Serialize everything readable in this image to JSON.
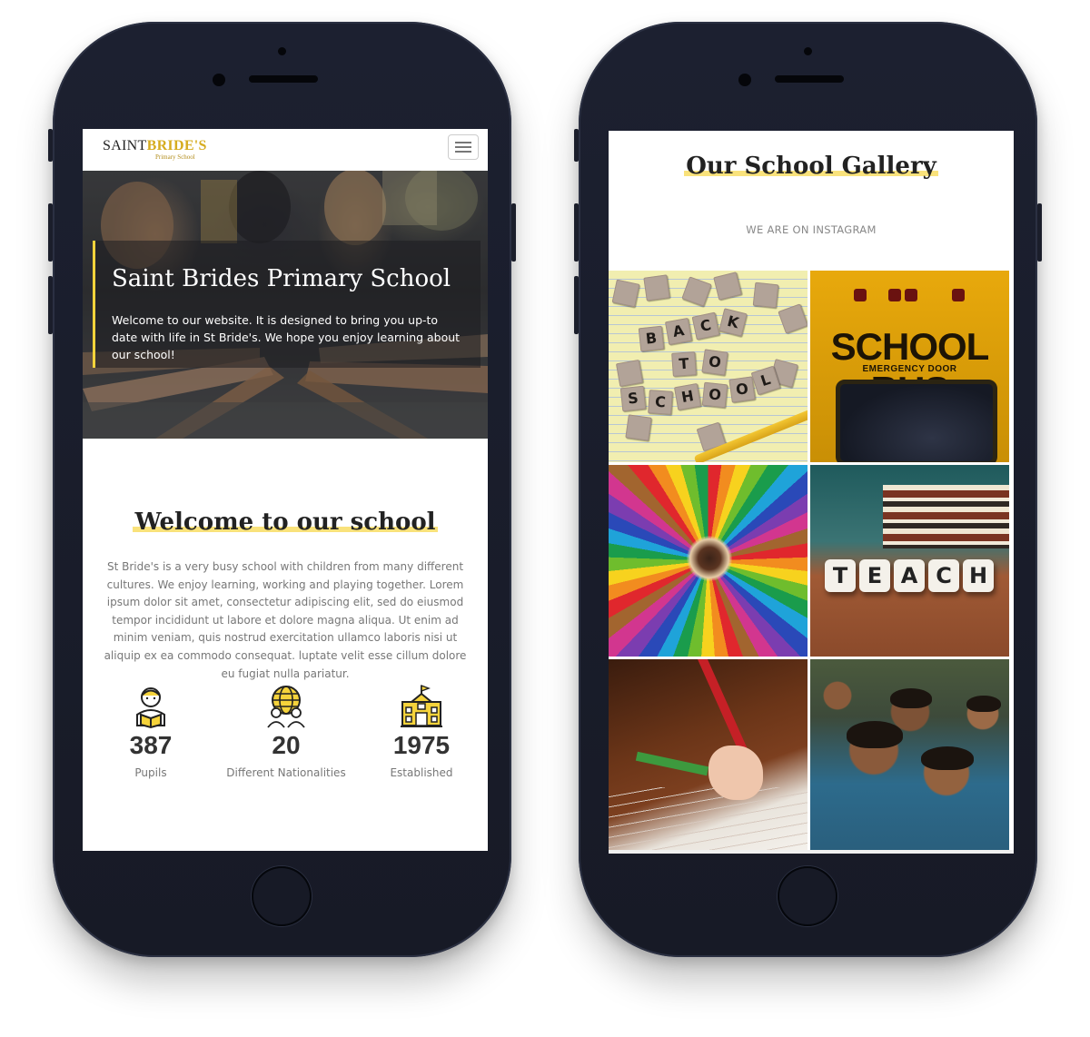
{
  "left_screen": {
    "logo": {
      "part1": "SAINT",
      "part2": "BRIDE'S",
      "sub": "Primary School"
    },
    "hero": {
      "title": "Saint Brides Primary School",
      "text": "Welcome to our website. It is designed to bring you up-to date with life in St Bride's. We hope you enjoy learning about our school!"
    },
    "welcome": {
      "title": "Welcome to our school",
      "text": "St Bride's is a very busy school with children from many different cultures. We enjoy learning, working and playing together. Lorem ipsum dolor sit amet, consectetur adipiscing elit, sed do eiusmod tempor incididunt ut labore et dolore magna aliqua. Ut enim ad minim veniam, quis nostrud exercitation ullamco laboris nisi ut aliquip ex ea commodo consequat. luptate velit esse cillum dolore eu fugiat nulla pariatur."
    },
    "stats": [
      {
        "value": "387",
        "label": "Pupils",
        "icon": "pupil-reading-icon"
      },
      {
        "value": "20",
        "label": "Different Nationalities",
        "icon": "globe-people-icon"
      },
      {
        "value": "1975",
        "label": "Established",
        "icon": "school-building-icon"
      }
    ]
  },
  "right_screen": {
    "gallery": {
      "title": "Our School Gallery",
      "subtitle": "WE ARE ON INSTAGRAM"
    },
    "tiles": {
      "t1": {
        "letters": [
          "B",
          "A",
          "C",
          "K",
          "T",
          "O",
          "S",
          "C",
          "H",
          "O",
          "O",
          "L"
        ]
      },
      "t2": {
        "main": "SCHOOL BUS",
        "sub": "EMERGENCY DOOR"
      },
      "t4": {
        "letters": [
          "T",
          "E",
          "A",
          "C",
          "H"
        ]
      }
    }
  },
  "colors": {
    "accent": "#f5d33b",
    "highlight": "#f9e27b",
    "logo_gold": "#d6ac1f",
    "phone": "#1a1d29"
  }
}
